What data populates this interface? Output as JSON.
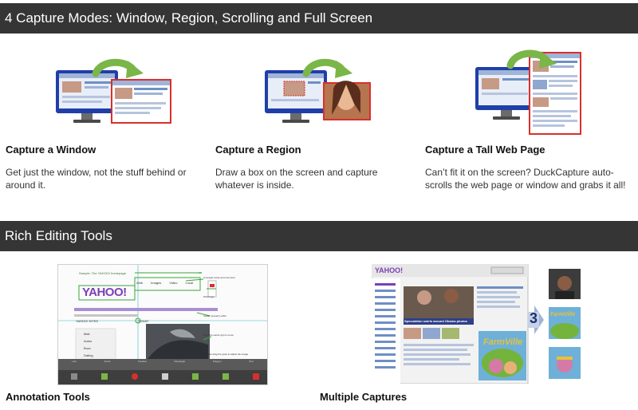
{
  "section1": {
    "heading": "4 Capture Modes: Window, Region, Scrolling and Full Screen",
    "features": [
      {
        "title": "Capture a Window",
        "desc": "Get just the window, not the stuff behind or around it."
      },
      {
        "title": "Capture a Region",
        "desc": "Draw a box on the screen and capture whatever is inside."
      },
      {
        "title": "Capture a Tall Web Page",
        "desc": "Can’t fit it on the screen? DuckCapture auto-scrolls the web page or window and grabs it all!"
      }
    ]
  },
  "section2": {
    "heading": "Rich Editing Tools",
    "features": [
      {
        "title": "Annotation Tools"
      },
      {
        "title": "Multiple Captures"
      }
    ],
    "annotation_shot": {
      "caption": "Sample: The YAHOO! homepage",
      "logo": "YAHOO!",
      "tabs": [
        "Web",
        "Images",
        "Video",
        "Local"
      ],
      "sidebar_header": "YAHOO! SITES",
      "sidebar_items": [
        "Mail",
        "Autos",
        "Buzz",
        "Dating"
      ],
      "today_label": "TODAY",
      "notes": [
        "A sample arrow and comment",
        "Wrist logo",
        "Instant property editor",
        "Drag the center grip to move",
        "You can drag the grips to adjust the image"
      ],
      "toolbar_labels": [
        "Line",
        "Arrow",
        "Freeline",
        "Rectangle",
        "Polygon",
        "Text"
      ]
    },
    "multi_shot": {
      "logo": "YAHOO!",
      "headline": "Speculation swirls around Obama photos",
      "step_number": "3",
      "game_title": "FarmVille"
    }
  },
  "colors": {
    "band_bg": "#353535",
    "band_text": "#ffffff",
    "arrow_green": "#7ab648",
    "capture_red": "#d9302c",
    "monitor_blue": "#1f3fa8"
  }
}
